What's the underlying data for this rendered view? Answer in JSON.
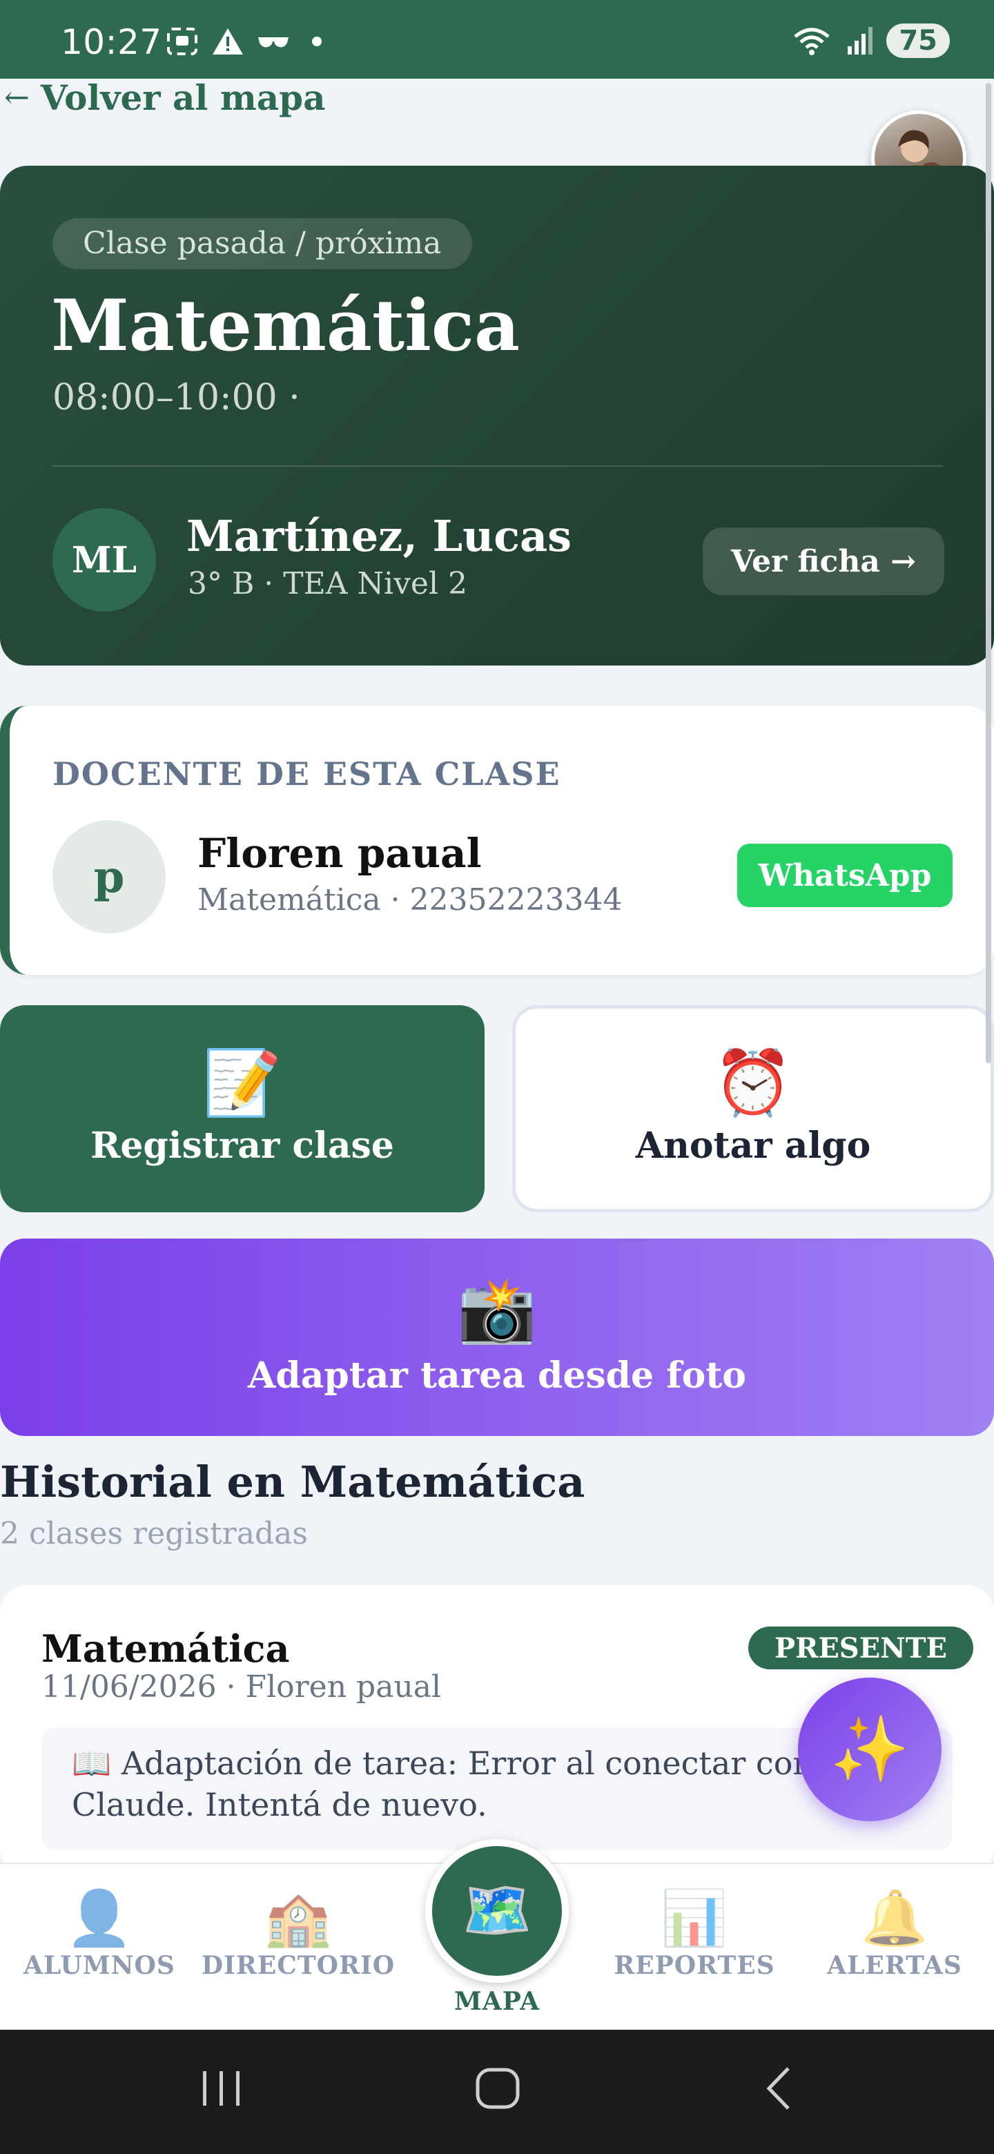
{
  "status_bar": {
    "time": "10:27",
    "battery": "75",
    "icons": [
      "screenshot-icon",
      "warning-icon",
      "glasses-icon",
      "dot-icon",
      "wifi-icon",
      "signal-icon"
    ]
  },
  "nav_back": {
    "arrow": "←",
    "label": "Volver al mapa"
  },
  "hero": {
    "badge": "Clase pasada / próxima",
    "title": "Matemática",
    "time": "08:00–10:00 ·",
    "student": {
      "initials": "ML",
      "name": "Martínez, Lucas",
      "meta": "3° B · TEA Nivel 2"
    },
    "view_button": "Ver ficha →"
  },
  "teacher": {
    "label": "DOCENTE DE ESTA CLASE",
    "initial": "p",
    "name": "Floren paual",
    "meta": "Matemática · 22352223344",
    "whatsapp_label": "WhatsApp"
  },
  "actions": {
    "register": {
      "emoji": "📝",
      "label": "Registrar clase"
    },
    "note": {
      "emoji": "⏰",
      "label": "Anotar algo"
    },
    "photo": {
      "emoji": "📸",
      "label": "Adaptar tarea desde foto"
    }
  },
  "history": {
    "title": "Historial en Matemática",
    "subtitle": "2 clases registradas",
    "items": [
      {
        "title": "Matemática",
        "meta": "11/06/2026 · Floren paual",
        "status": "PRESENTE",
        "note_line1": "📖 Adaptación de tarea: Error al conectar con",
        "note_line2": "Claude. Intentá de nuevo."
      }
    ]
  },
  "fab": {
    "emoji": "✨"
  },
  "bottom_nav": {
    "items": [
      {
        "icon": "👤",
        "label": "ALUMNOS"
      },
      {
        "icon": "🏫",
        "label": "DIRECTORIO"
      },
      {
        "icon": "🗺️",
        "label": "MAPA"
      },
      {
        "icon": "📊",
        "label": "REPORTES"
      },
      {
        "icon": "🔔",
        "label": "ALERTAS"
      }
    ],
    "active": "MAPA"
  },
  "colors": {
    "brand_green": "#2e6a4f",
    "hero_dark": "#1f3c2d",
    "whatsapp": "#25d366",
    "purple": "#7b3fe9",
    "background": "#f0f3f7"
  }
}
